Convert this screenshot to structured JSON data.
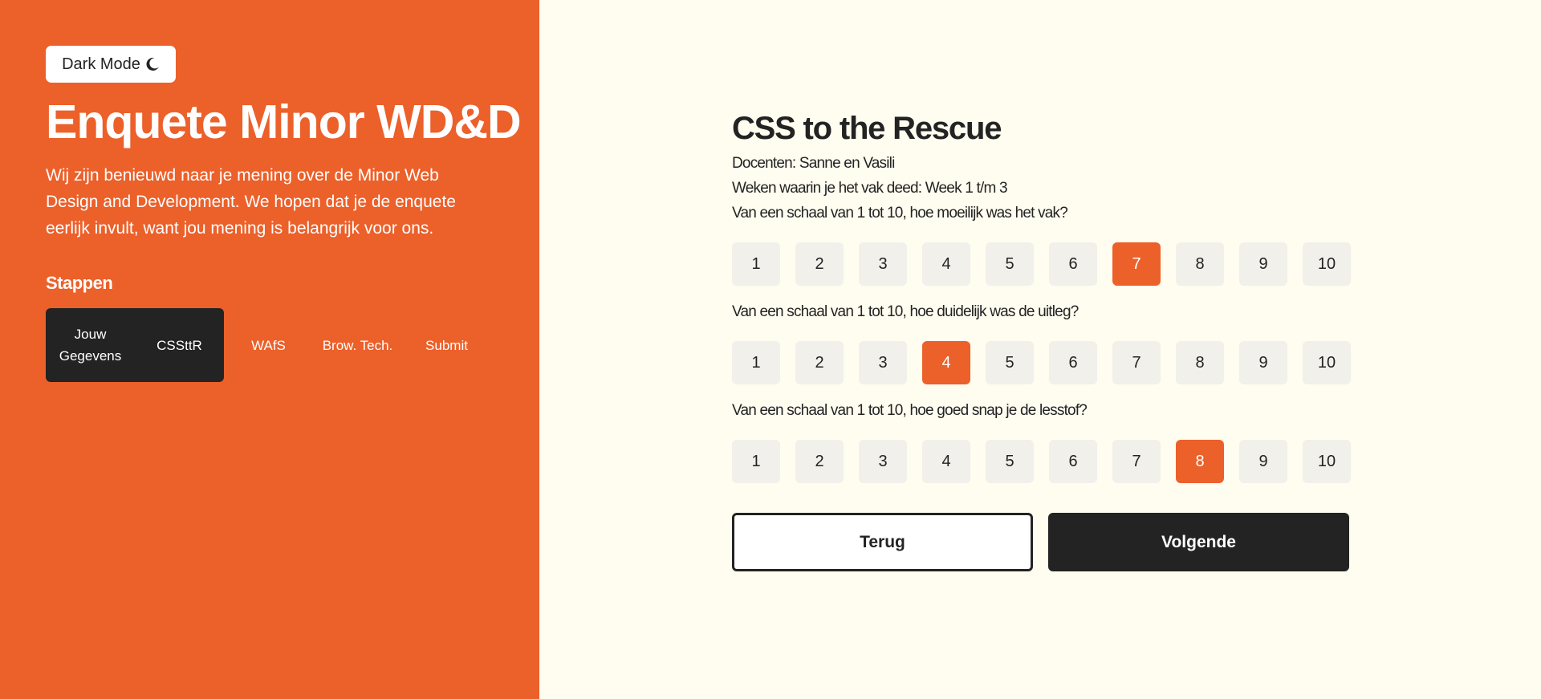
{
  "sidebar": {
    "dark_mode_label": "Dark Mode",
    "title": "Enquete Minor WD&D",
    "intro": "Wij zijn benieuwd naar je mening over de Minor Web Design and Development. We hopen dat je de enquete eerlijk invult, want jou mening is belangrijk voor ons.",
    "steps_title": "Stappen",
    "steps": [
      {
        "label": "Jouw Gegevens",
        "state": "done"
      },
      {
        "label": "CSSttR",
        "state": "current"
      },
      {
        "label": "WAfS",
        "state": "todo"
      },
      {
        "label": "Brow. Tech.",
        "state": "todo"
      },
      {
        "label": "Submit",
        "state": "todo"
      }
    ]
  },
  "main": {
    "title": "CSS to the Rescue",
    "teachers": "Docenten: Sanne en Vasili",
    "weeks": "Weken waarin je het vak deed: Week 1 t/m 3",
    "questions": [
      {
        "text": "Van een schaal van 1 tot 10, hoe moeilijk was het vak?",
        "selected": 7
      },
      {
        "text": "Van een schaal van 1 tot 10, hoe duidelijk was de uitleg?",
        "selected": 4
      },
      {
        "text": "Van een schaal van 1 tot 10, hoe goed snap je de lesstof?",
        "selected": 8
      }
    ],
    "scale": [
      "1",
      "2",
      "3",
      "4",
      "5",
      "6",
      "7",
      "8",
      "9",
      "10"
    ],
    "back_label": "Terug",
    "next_label": "Volgende"
  },
  "colors": {
    "accent": "#ec602a",
    "dark": "#232323",
    "background": "#fffcf0",
    "option_bg": "#f2f0ea"
  }
}
